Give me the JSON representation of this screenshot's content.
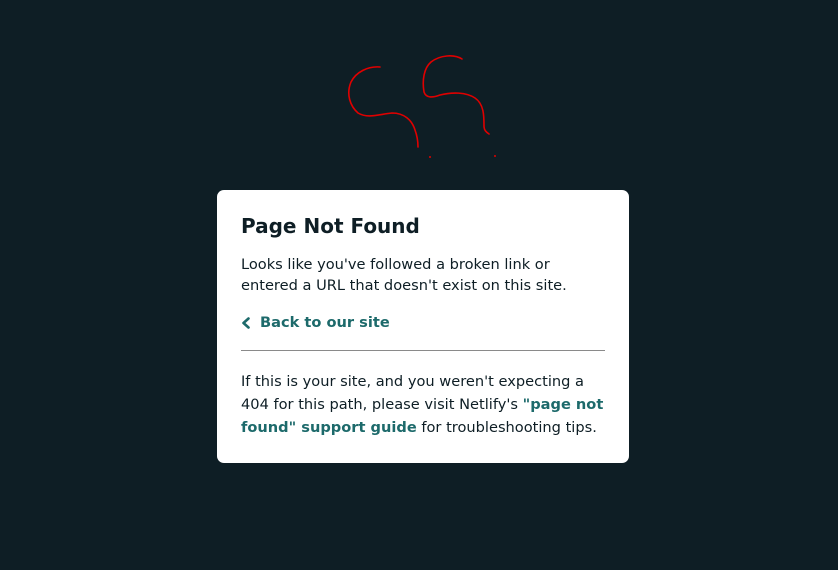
{
  "card": {
    "title": "Page Not Found",
    "description": "Looks like you've followed a broken link or entered a URL that doesn't exist on this site.",
    "back_link": {
      "icon": "chevron-left-icon",
      "label": "Back to our site"
    },
    "help": {
      "text_before": "If this is your site, and you weren't expecting a 404 for this path, please visit Netlify's ",
      "guide_link": "\"page not found\" support guide",
      "text_after": " for troubleshooting tips."
    }
  },
  "colors": {
    "background": "#0e1e25",
    "card": "#ffffff",
    "link": "#1d6a6b",
    "annotation": "#e00000"
  }
}
